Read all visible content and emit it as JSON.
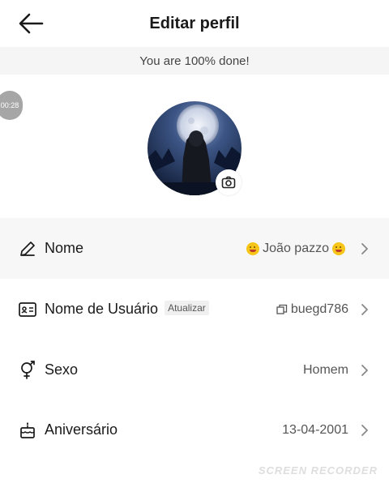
{
  "header": {
    "title": "Editar perfil",
    "back_icon": "arrow-left-icon"
  },
  "progress": {
    "text": "You are 100% done!",
    "percent": 100
  },
  "overlay": {
    "timer": "00:28",
    "watermark": "SCREEN RECORDER"
  },
  "avatar": {
    "camera_icon": "camera-icon"
  },
  "rows": [
    {
      "icon": "pencil-icon",
      "label": "Nome",
      "value": "João pazzo"
    },
    {
      "icon": "id-card-icon",
      "label": "Nome de Usuário",
      "tag": "Atualizar",
      "value": "buegd786",
      "value_icon": "copy-icon"
    },
    {
      "icon": "gender-icon",
      "label": "Sexo",
      "value": "Homem"
    },
    {
      "icon": "cake-icon",
      "label": "Aniversário",
      "value": "13-04-2001"
    }
  ],
  "colors": {
    "background": "#ffffff",
    "highlight_row": "#f7f7f7",
    "progress_bg": "#f5f5f5",
    "text_primary": "#1a1a1a",
    "text_secondary": "#555555"
  }
}
